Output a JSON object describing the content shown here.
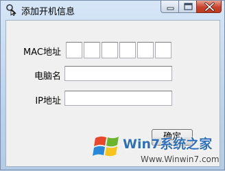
{
  "window": {
    "title": "添加开机信息",
    "app_icon": "key-cursor-icon"
  },
  "title_buttons": {
    "minimize_icon": "minimize-icon",
    "maximize_icon": "maximize-icon",
    "close_icon": "close-icon"
  },
  "form": {
    "mac_label": "MAC地址",
    "mac_segments": [
      "",
      "",
      "",
      "",
      "",
      ""
    ],
    "computer_name_label": "电脑名",
    "computer_name_value": "",
    "ip_label": "IP地址",
    "ip_value": ""
  },
  "ok_button_label": "确定",
  "watermark": {
    "logo_icon": "windows-flag-icon",
    "text": "Win7系统之家",
    "url": "Www.Winwin7.com"
  },
  "colors": {
    "close_button": "#c8432d",
    "title_bar": "#bcd3ee",
    "watermark_text": "#2f6fb8"
  }
}
